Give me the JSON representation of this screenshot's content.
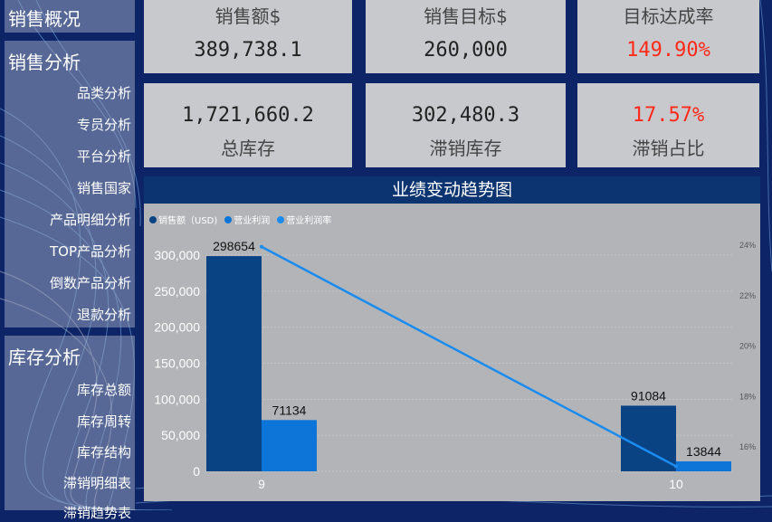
{
  "sidebar": {
    "overview_title": "销售概况",
    "sales_title": "销售分析",
    "sales_items": [
      "品类分析",
      "专员分析",
      "平台分析",
      "销售国家",
      "产品明细分析",
      "TOP产品分析",
      "倒数产品分析",
      "退款分析"
    ],
    "inventory_title": "库存分析",
    "inventory_items": [
      "库存总额",
      "库存周转",
      "库存结构",
      "滞销明细表",
      "滞销趋势表"
    ]
  },
  "kpis": {
    "sales_amount": {
      "label": "销售额$",
      "value": "389,738.1"
    },
    "sales_target": {
      "label": "销售目标$",
      "value": "260,000"
    },
    "target_rate": {
      "label": "目标达成率",
      "value": "149.90%"
    },
    "total_inventory": {
      "label": "总库存",
      "value": "1,721,660.2"
    },
    "slow_inventory": {
      "label": "滞销库存",
      "value": "302,480.3"
    },
    "slow_ratio": {
      "label": "滞销占比",
      "value": "17.57%"
    }
  },
  "colors": {
    "sales": "#0a4384",
    "profit": "#0d74d8",
    "rate": "#1a8cf0",
    "highlight": "#ff2a1a"
  },
  "chart_data": {
    "type": "bar",
    "title": "业绩变动趋势图",
    "categories": [
      "9",
      "10"
    ],
    "series": [
      {
        "name": "销售额（USD)",
        "type": "bar",
        "values": [
          298654,
          91084
        ]
      },
      {
        "name": "营业利润",
        "type": "bar",
        "values": [
          71134,
          13844
        ]
      },
      {
        "name": "营业利润率",
        "type": "line",
        "axis": "right",
        "values": [
          23.9,
          15.2
        ]
      }
    ],
    "y_ticks": [
      "0",
      "50,000",
      "100,000",
      "150,000",
      "200,000",
      "250,000",
      "300,000"
    ],
    "ylim": [
      0,
      300000
    ],
    "y2_ticks": [
      "16%",
      "18%",
      "20%",
      "22%",
      "24%"
    ],
    "y2lim": [
      15,
      24
    ],
    "legend": "top-left"
  }
}
